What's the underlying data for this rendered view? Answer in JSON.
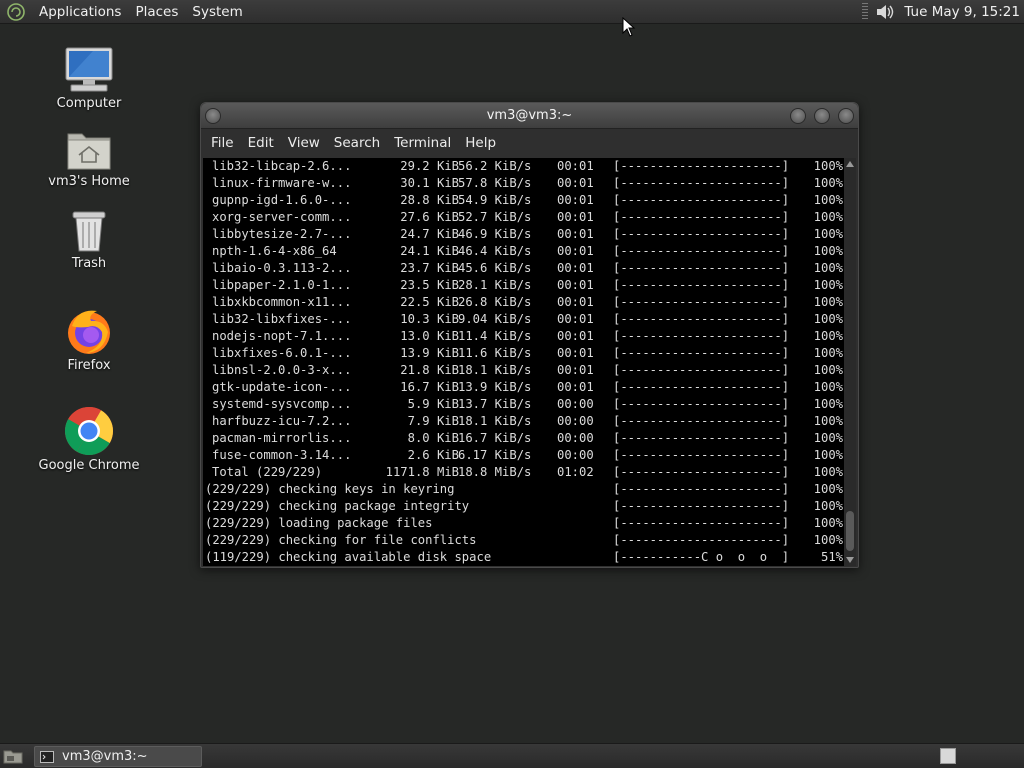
{
  "top_panel": {
    "menus": [
      "Applications",
      "Places",
      "System"
    ],
    "clock": "Tue May  9, 15:21"
  },
  "desktop": {
    "icons": [
      {
        "label": "Computer",
        "icon": "computer-icon"
      },
      {
        "label": "vm3's Home",
        "icon": "home-folder-icon"
      },
      {
        "label": "Trash",
        "icon": "trash-icon"
      },
      {
        "label": "Firefox",
        "icon": "firefox-icon"
      },
      {
        "label": "Google Chrome",
        "icon": "chrome-icon"
      }
    ]
  },
  "window": {
    "title": "vm3@vm3:~",
    "menus": [
      "File",
      "Edit",
      "View",
      "Search",
      "Terminal",
      "Help"
    ]
  },
  "terminal": {
    "downloads": [
      {
        "name": "lib32-libcap-2.6...",
        "size": "29.2 KiB",
        "speed": "56.2 KiB/s",
        "time": "00:01",
        "bar": "[----------------------]",
        "pct": "100%"
      },
      {
        "name": "linux-firmware-w...",
        "size": "30.1 KiB",
        "speed": "57.8 KiB/s",
        "time": "00:01",
        "bar": "[----------------------]",
        "pct": "100%"
      },
      {
        "name": "gupnp-igd-1.6.0-...",
        "size": "28.8 KiB",
        "speed": "54.9 KiB/s",
        "time": "00:01",
        "bar": "[----------------------]",
        "pct": "100%"
      },
      {
        "name": "xorg-server-comm...",
        "size": "27.6 KiB",
        "speed": "52.7 KiB/s",
        "time": "00:01",
        "bar": "[----------------------]",
        "pct": "100%"
      },
      {
        "name": "libbytesize-2.7-...",
        "size": "24.7 KiB",
        "speed": "46.9 KiB/s",
        "time": "00:01",
        "bar": "[----------------------]",
        "pct": "100%"
      },
      {
        "name": "npth-1.6-4-x86_64",
        "size": "24.1 KiB",
        "speed": "46.4 KiB/s",
        "time": "00:01",
        "bar": "[----------------------]",
        "pct": "100%"
      },
      {
        "name": "libaio-0.3.113-2...",
        "size": "23.7 KiB",
        "speed": "45.6 KiB/s",
        "time": "00:01",
        "bar": "[----------------------]",
        "pct": "100%"
      },
      {
        "name": "libpaper-2.1.0-1...",
        "size": "23.5 KiB",
        "speed": "28.1 KiB/s",
        "time": "00:01",
        "bar": "[----------------------]",
        "pct": "100%"
      },
      {
        "name": "libxkbcommon-x11...",
        "size": "22.5 KiB",
        "speed": "26.8 KiB/s",
        "time": "00:01",
        "bar": "[----------------------]",
        "pct": "100%"
      },
      {
        "name": "lib32-libxfixes-...",
        "size": "10.3 KiB",
        "speed": "9.04 KiB/s",
        "time": "00:01",
        "bar": "[----------------------]",
        "pct": "100%"
      },
      {
        "name": "nodejs-nopt-7.1....",
        "size": "13.0 KiB",
        "speed": "11.4 KiB/s",
        "time": "00:01",
        "bar": "[----------------------]",
        "pct": "100%"
      },
      {
        "name": "libxfixes-6.0.1-...",
        "size": "13.9 KiB",
        "speed": "11.6 KiB/s",
        "time": "00:01",
        "bar": "[----------------------]",
        "pct": "100%"
      },
      {
        "name": "libnsl-2.0.0-3-x...",
        "size": "21.8 KiB",
        "speed": "18.1 KiB/s",
        "time": "00:01",
        "bar": "[----------------------]",
        "pct": "100%"
      },
      {
        "name": "gtk-update-icon-...",
        "size": "16.7 KiB",
        "speed": "13.9 KiB/s",
        "time": "00:01",
        "bar": "[----------------------]",
        "pct": "100%"
      },
      {
        "name": "systemd-sysvcomp...",
        "size": "5.9 KiB",
        "speed": "13.7 KiB/s",
        "time": "00:00",
        "bar": "[----------------------]",
        "pct": "100%"
      },
      {
        "name": "harfbuzz-icu-7.2...",
        "size": "7.9 KiB",
        "speed": "18.1 KiB/s",
        "time": "00:00",
        "bar": "[----------------------]",
        "pct": "100%"
      },
      {
        "name": "pacman-mirrorlis...",
        "size": "8.0 KiB",
        "speed": "16.7 KiB/s",
        "time": "00:00",
        "bar": "[----------------------]",
        "pct": "100%"
      },
      {
        "name": "fuse-common-3.14...",
        "size": "2.6 KiB",
        "speed": "6.17 KiB/s",
        "time": "00:00",
        "bar": "[----------------------]",
        "pct": "100%"
      },
      {
        "name": "Total (229/229)",
        "size": "1171.8 MiB",
        "speed": "18.8 MiB/s",
        "time": "01:02",
        "bar": "[----------------------]",
        "pct": "100%"
      }
    ],
    "steps": [
      {
        "text": "(229/229) checking keys in keyring",
        "bar": "[----------------------]",
        "pct": "100%"
      },
      {
        "text": "(229/229) checking package integrity",
        "bar": "[----------------------]",
        "pct": "100%"
      },
      {
        "text": "(229/229) loading package files",
        "bar": "[----------------------]",
        "pct": "100%"
      },
      {
        "text": "(229/229) checking for file conflicts",
        "bar": "[----------------------]",
        "pct": "100%"
      },
      {
        "text": "(119/229) checking available disk space",
        "bar": "[-----------C o  o  o  ]",
        "pct": "51%"
      }
    ]
  },
  "bottom_panel": {
    "task_label": "vm3@vm3:~"
  }
}
